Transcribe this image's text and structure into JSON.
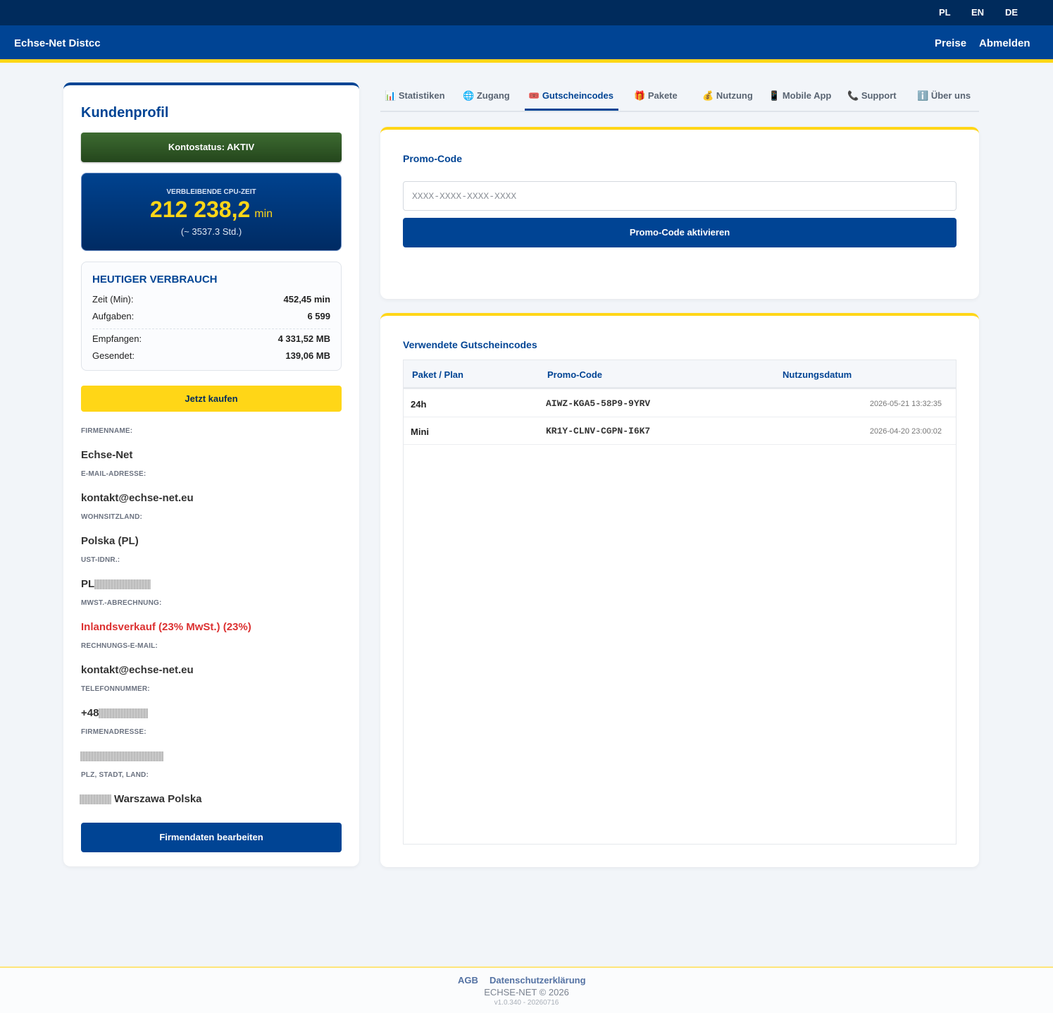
{
  "topbar": {
    "languages": [
      "PL",
      "EN",
      "DE"
    ]
  },
  "navbar": {
    "brand": "Echse-Net Distcc",
    "links": [
      "Preise",
      "Abmelden"
    ]
  },
  "profile": {
    "title": "Kundenprofil",
    "status": "Kontostatus: AKTIV",
    "cpu": {
      "label": "VERBLEIBENDE CPU-ZEIT",
      "value": "212 238,2",
      "unit": "min",
      "hours": "(~ 3537.3 Std.)"
    },
    "usage": {
      "title": "HEUTIGER VERBRAUCH",
      "rows": [
        {
          "label": "Zeit (Min):",
          "value": "452,45 min"
        },
        {
          "label": "Aufgaben:",
          "value": "6 599"
        },
        {
          "label": "Empfangen:",
          "value": "4 331,52 MB"
        },
        {
          "label": "Gesendet:",
          "value": "139,06 MB"
        }
      ]
    },
    "buy_label": "Jetzt kaufen",
    "fields": [
      {
        "label": "FIRMENNAME:",
        "value": "Echse-Net"
      },
      {
        "label": "E-MAIL-ADRESSE:",
        "value": "kontakt@echse-net.eu"
      },
      {
        "label": "WOHNSITZLAND:",
        "value": "Polska (PL)"
      },
      {
        "label": "UST-IDNR.:",
        "value": "PL"
      },
      {
        "label": "MWST.-ABRECHNUNG:",
        "value": "Inlandsverkauf (23% MwSt.) (23%)"
      },
      {
        "label": "RECHNUNGS-E-MAIL:",
        "value": "kontakt@echse-net.eu"
      },
      {
        "label": "TELEFONNUMMER:",
        "value": "+48"
      },
      {
        "label": "FIRMENADRESSE:",
        "value": ""
      },
      {
        "label": "PLZ, STADT, LAND:",
        "value": "Warszawa Polska"
      }
    ],
    "edit_label": "Firmendaten bearbeiten"
  },
  "tabs": [
    {
      "icon": "📊",
      "label": "Statistiken"
    },
    {
      "icon": "🌐",
      "label": "Zugang"
    },
    {
      "icon": "🎟️",
      "label": "Gutscheincodes"
    },
    {
      "icon": "🎁",
      "label": "Pakete"
    },
    {
      "icon": "💰",
      "label": "Nutzung"
    },
    {
      "icon": "📱",
      "label": "Mobile App"
    },
    {
      "icon": "📞",
      "label": "Support"
    },
    {
      "icon": "ℹ️",
      "label": "Über uns"
    }
  ],
  "promo": {
    "title": "Promo-Code",
    "placeholder": "XXXX-XXXX-XXXX-XXXX",
    "button": "Promo-Code aktivieren"
  },
  "used_codes": {
    "title": "Verwendete Gutscheincodes",
    "headers": [
      "Paket / Plan",
      "Promo-Code",
      "Nutzungsdatum"
    ],
    "rows": [
      {
        "plan": "24h",
        "code": "AIWZ-KGA5-58P9-9YRV",
        "date": "2026-05-21 13:32:35"
      },
      {
        "plan": "Mini",
        "code": "KR1Y-CLNV-CGPN-I6K7",
        "date": "2026-04-20 23:00:02"
      }
    ]
  },
  "footer": {
    "links": [
      "AGB",
      "Datenschutzerklärung"
    ],
    "copyright": "ECHSE-NET © 2026",
    "version": "v1.0.340 - 20260716"
  }
}
